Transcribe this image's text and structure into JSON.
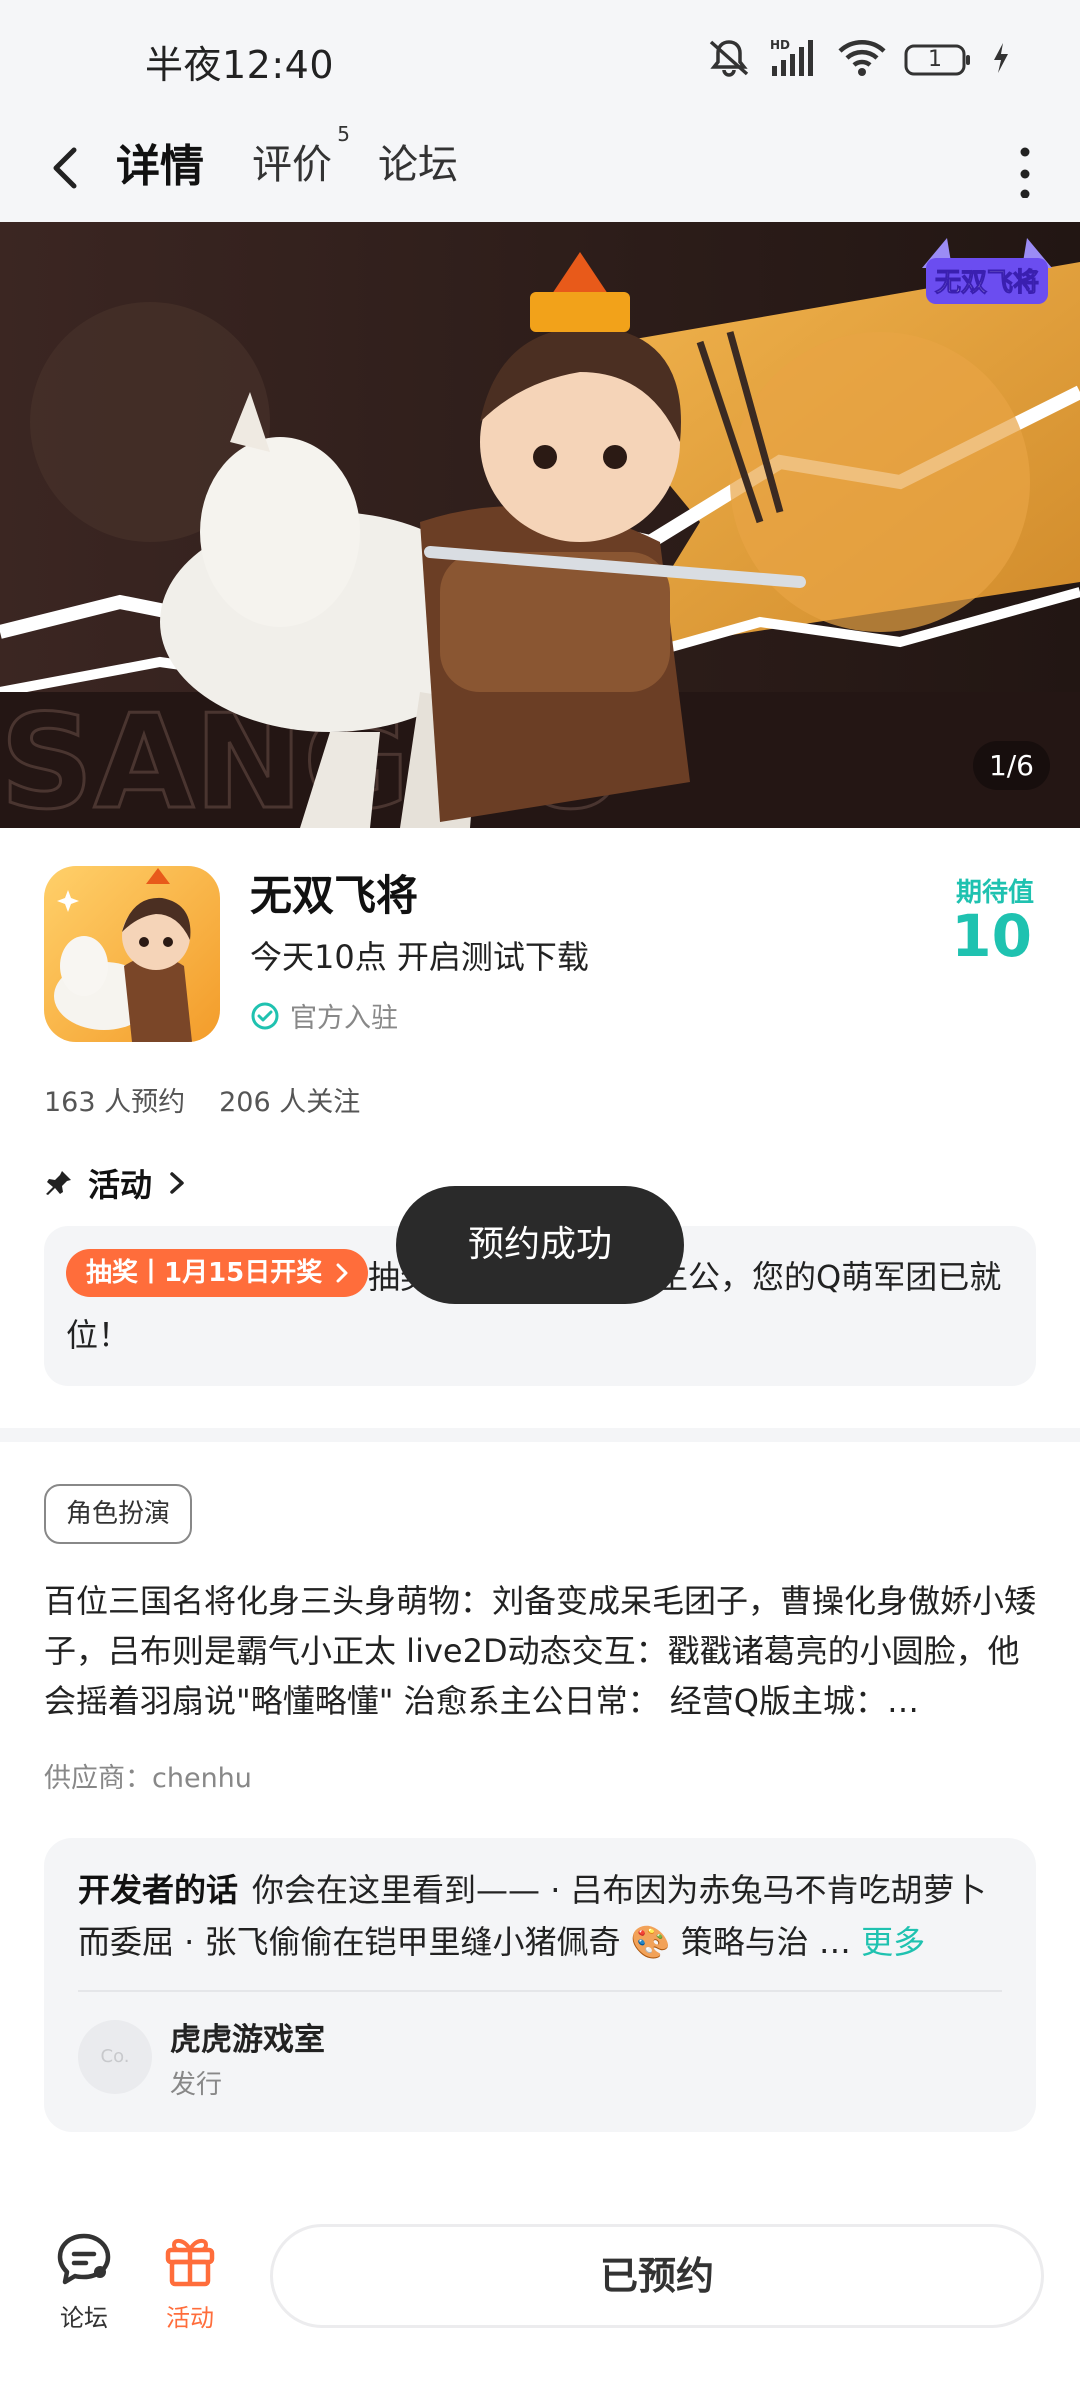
{
  "status_bar": {
    "time": "半夜12:40",
    "signal_label": "HD",
    "battery": "1"
  },
  "nav": {
    "tabs": [
      {
        "label": "详情",
        "active": true
      },
      {
        "label": "评价",
        "badge": "5"
      },
      {
        "label": "论坛"
      }
    ]
  },
  "banner": {
    "counter": "1/6",
    "logo_text": "无双飞将",
    "bg_text": "SANGUO"
  },
  "app": {
    "name": "无双飞将",
    "desc": "今天10点 开启测试下载",
    "official_label": "官方入驻",
    "expect_label": "期待值",
    "expect_value": "10",
    "reservations": "163 人预约",
    "followers": "206 人关注"
  },
  "activity": {
    "title": "活动",
    "tag": "抽奖丨1月15日开奖",
    "text": "抽奖丨【无双飞将】主公，您的Q萌军团已就位！"
  },
  "toast": "预约成功",
  "genre_tag": "角色扮演",
  "intro": "百位三国名将化身三头身萌物：刘备变成呆毛团子，曹操化身傲娇小矮子，吕布则是霸气小正太 live2D动态交互：戳戳诸葛亮的小圆脸，他会摇着羽扇说\"略懂略懂\" 治愈系主公日常： 经营Q版主城：…",
  "supplier": "供应商：chenhu",
  "developer": {
    "label": "开发者的话",
    "text": "你会在这里看到—— · 吕布因为赤兔马不肯吃胡萝卜而委屈 · 张飞偷偷在铠甲里缝小猪佩奇 🎨 策略与治 …",
    "more": "更多",
    "studio_name": "虎虎游戏室",
    "studio_role": "发行",
    "avatar_text": "Co."
  },
  "bottom": {
    "forum_label": "论坛",
    "activity_label": "活动",
    "reserved_button": "已预约"
  },
  "colors": {
    "accent": "#1fc2b0",
    "orange": "#ff6d3b",
    "toast_bg": "#2a2a2a"
  }
}
